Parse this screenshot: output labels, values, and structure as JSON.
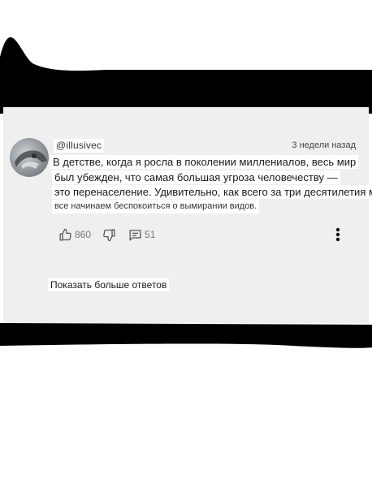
{
  "comment": {
    "author_handle": "@illusivec",
    "time_ago": "3 недели назад",
    "text_lines": [
      "В детстве, когда я росла в поколении миллениалов, весь мир",
      "был убежден, что самая большая угроза человечеству —",
      "это перенаселение. Удивительно, как всего за три десятилетия мы",
      "все начинаем беспокоиться о вымирании видов."
    ],
    "like_count": "860",
    "reply_count": "51"
  },
  "replies": {
    "show_more_label": "Показать больше ответов"
  },
  "icons": {
    "like": "thumbs-up-icon",
    "dislike": "thumbs-down-icon",
    "reply": "comment-icon",
    "menu": "more-vertical-icon"
  }
}
